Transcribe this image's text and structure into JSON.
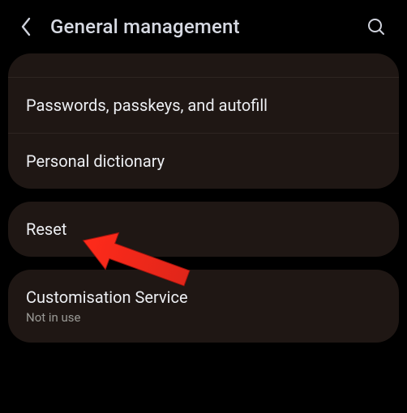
{
  "header": {
    "title": "General management"
  },
  "group1": {
    "items": [
      {
        "label": "Passwords, passkeys, and autofill"
      },
      {
        "label": "Personal dictionary"
      }
    ]
  },
  "group2": {
    "items": [
      {
        "label": "Reset"
      }
    ]
  },
  "group3": {
    "items": [
      {
        "label": "Customisation Service",
        "sub": "Not in use"
      }
    ]
  }
}
